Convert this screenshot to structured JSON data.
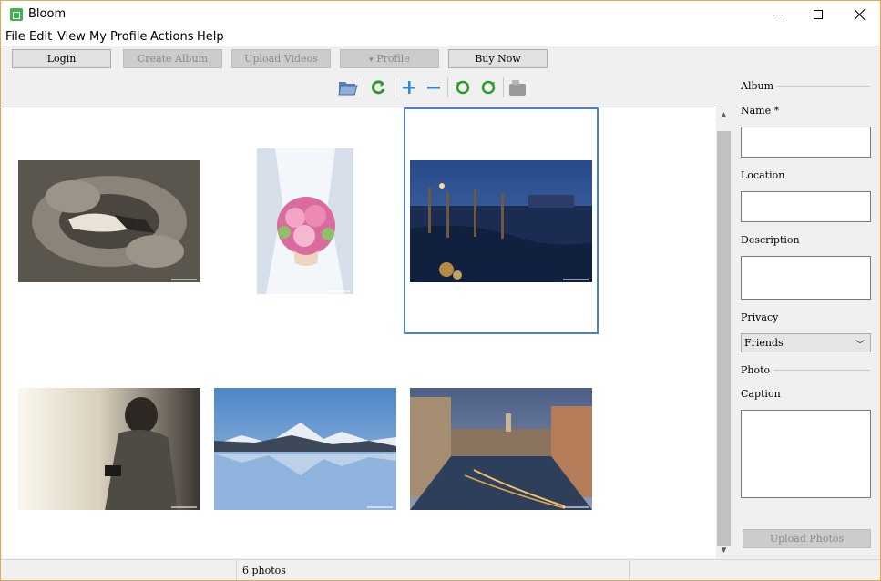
{
  "window": {
    "title": "Bloom"
  },
  "menu": [
    "File",
    "Edit",
    "View",
    "My Profile",
    "Actions",
    "Help"
  ],
  "top_buttons": {
    "login": "Login",
    "create_album": "Create Album",
    "upload_videos": "Upload Videos",
    "profile": "Profile",
    "profile_arrow": "▾",
    "buy_now": "Buy Now"
  },
  "toolbar_icons": [
    "folder-open-icon",
    "refresh-icon",
    "zoom-in-icon",
    "zoom-out-icon",
    "rotate-left-icon",
    "rotate-right-icon",
    "delete-icon"
  ],
  "gallery": {
    "photo_count": 6,
    "photos": [
      {
        "name": "couple-on-pavement",
        "colors": [
          "#4a453f",
          "#8f887d"
        ]
      },
      {
        "name": "bride-bouquet",
        "colors": [
          "#e8eef5",
          "#d46a9b"
        ]
      },
      {
        "name": "venice-gondolas-night",
        "colors": [
          "#1c2f55",
          "#3f5fa0"
        ]
      },
      {
        "name": "woman-with-camera",
        "colors": [
          "#f4efe2",
          "#3b3630"
        ]
      },
      {
        "name": "mountain-lake-reflection",
        "colors": [
          "#6e9bd0",
          "#d8e4f0"
        ]
      },
      {
        "name": "venice-canal-dusk",
        "colors": [
          "#5a6b8a",
          "#c9a06a"
        ]
      }
    ],
    "selected_index": 2
  },
  "side_panel": {
    "album_title": "Album",
    "name_label": "Name *",
    "name_value": "",
    "location_label": "Location",
    "location_value": "",
    "description_label": "Description",
    "description_value": "",
    "privacy_label": "Privacy",
    "privacy_value": "Friends",
    "photo_title": "Photo",
    "caption_label": "Caption",
    "caption_value": "",
    "upload_button": "Upload Photos"
  },
  "status": {
    "text": "6 photos"
  },
  "colors": {
    "selection_border": "#4a7fd4",
    "window_border": "#e3a857"
  }
}
